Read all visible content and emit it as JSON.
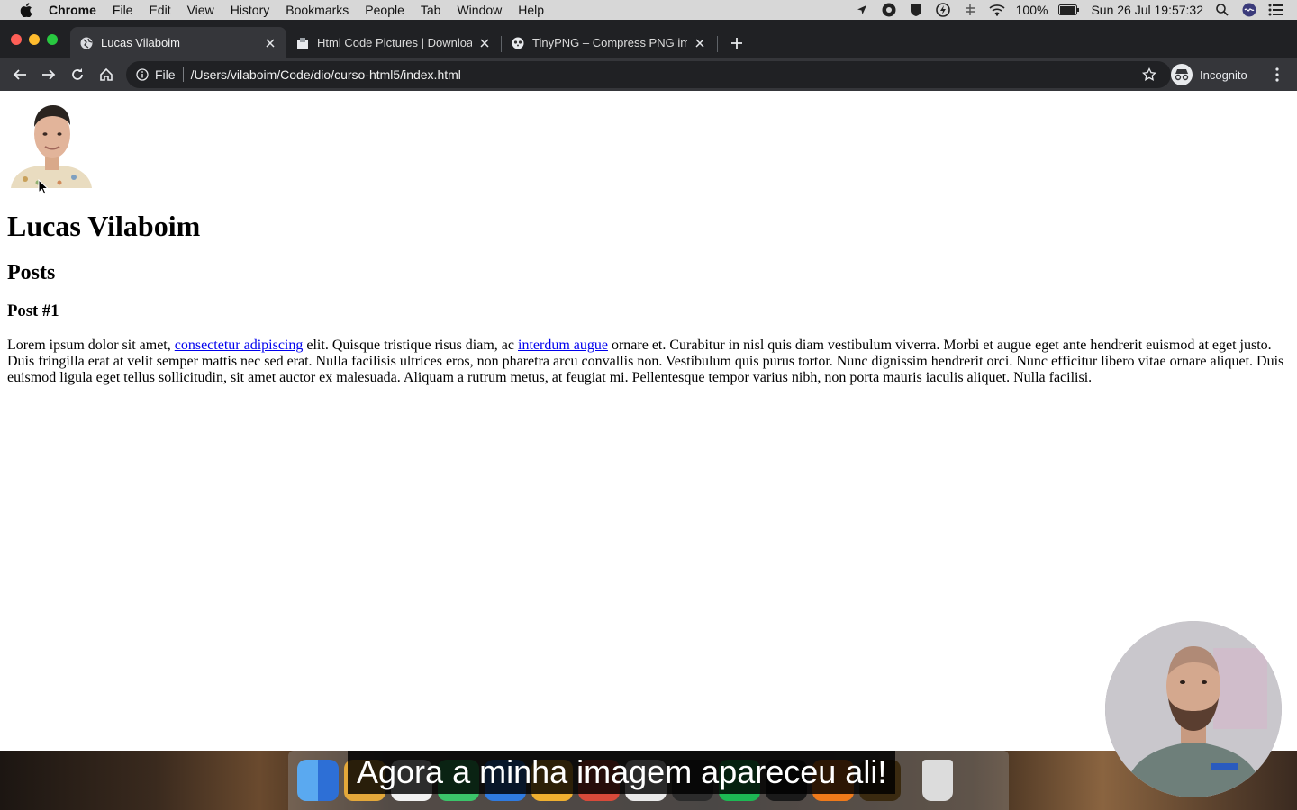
{
  "menubar": {
    "app_name": "Chrome",
    "items": [
      "File",
      "Edit",
      "View",
      "History",
      "Bookmarks",
      "People",
      "Tab",
      "Window",
      "Help"
    ],
    "battery": "100%",
    "clock": "Sun 26 Jul  19:57:32"
  },
  "tabs": [
    {
      "title": "Lucas Vilaboim",
      "active": true
    },
    {
      "title": "Html Code Pictures | Download",
      "active": false
    },
    {
      "title": "TinyPNG – Compress PNG images",
      "active": false
    }
  ],
  "omnibox": {
    "scheme": "File",
    "url": "/Users/vilaboim/Code/dio/curso-html5/index.html"
  },
  "profile": {
    "label": "Incognito"
  },
  "page": {
    "title": "Lucas Vilaboim",
    "section": "Posts",
    "post_title": "Post #1",
    "paragraph": {
      "t1": "Lorem ipsum dolor sit amet, ",
      "link1": "consectetur adipiscing",
      "t2": " elit. Quisque tristique risus diam, ac ",
      "link2": "interdum augue",
      "t3": " ornare et. Curabitur in nisl quis diam vestibulum viverra. Morbi et augue eget ante hendrerit euismod at eget justo. Duis fringilla erat at velit semper mattis nec sed erat. Nulla facilisis ultrices eros, non pharetra arcu convallis non. Vestibulum quis purus tortor. Nunc dignissim hendrerit orci. Nunc efficitur libero vitae ornare aliquet. Duis euismod ligula eget tellus sollicitudin, sit amet auctor ex malesuada. Aliquam a rutrum metus, at feugiat mi. Pellentesque tempor varius nibh, non porta mauris iaculis aliquet. Nulla facilisi."
    }
  },
  "caption": "Agora a minha imagem apareceu ali!",
  "colors": {
    "tabstrip": "#202124",
    "toolbar": "#35363a",
    "link": "#0000ee"
  }
}
